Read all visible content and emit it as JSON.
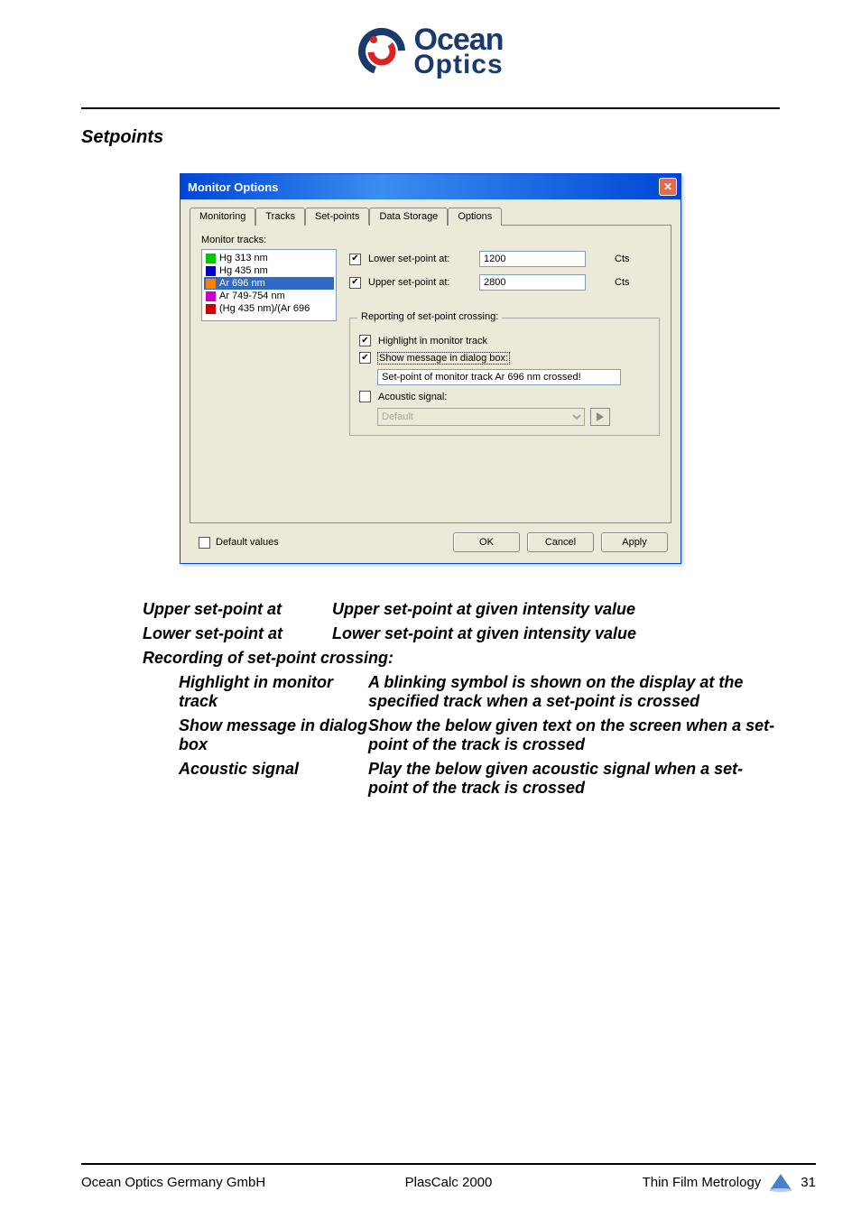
{
  "header": {
    "logo_line1": "Ocean",
    "logo_line2": "Optics"
  },
  "section_title": "Setpoints",
  "dialog": {
    "title": "Monitor Options",
    "tabs": [
      "Monitoring",
      "Tracks",
      "Set-points",
      "Data Storage",
      "Options"
    ],
    "active_tab_index": 2,
    "monitor_tracks_label": "Monitor tracks:",
    "tracks": [
      {
        "label": "Hg 313 nm",
        "color": "#00c800",
        "selected": false
      },
      {
        "label": "Hg 435 nm",
        "color": "#0000c8",
        "selected": false
      },
      {
        "label": "Ar 696 nm",
        "color": "#ff8000",
        "selected": true
      },
      {
        "label": "Ar 749-754 nm",
        "color": "#c800c8",
        "selected": false
      },
      {
        "label": "(Hg 435 nm)/(Ar 696",
        "color": "#c80000",
        "selected": false
      }
    ],
    "lower": {
      "checked": true,
      "label": "Lower set-point at:",
      "value": "1200",
      "unit": "Cts"
    },
    "upper": {
      "checked": true,
      "label": "Upper set-point at:",
      "value": "2800",
      "unit": "Cts"
    },
    "reporting": {
      "group_title": "Reporting of set-point crossing:",
      "highlight": {
        "checked": true,
        "label": "Highlight in monitor track"
      },
      "show_msg": {
        "checked": true,
        "label": "Show message in dialog box:",
        "value": "Set-point of monitor track Ar 696 nm crossed!"
      },
      "acoustic": {
        "checked": false,
        "label": "Acoustic signal:",
        "value": "Default"
      }
    },
    "default_values": {
      "checked": false,
      "label": "Default values"
    },
    "buttons": {
      "ok": "OK",
      "cancel": "Cancel",
      "apply": "Apply"
    }
  },
  "definitions": {
    "upper_term": "Upper set-point at",
    "upper_desc": "Upper set-point at given intensity value",
    "lower_term": "Lower set-point at",
    "lower_desc": "Lower set-point at given intensity value",
    "recording_heading": "Recording of set-point crossing:",
    "highlight_term": "Highlight in monitor track",
    "highlight_desc": "A blinking symbol is shown on the display at the specified track when a set-point is crossed",
    "showmsg_term": "Show message in dialog box",
    "showmsg_desc": "Show the below given text on the screen when a set-point of the track is crossed",
    "acoustic_term": "Acoustic signal",
    "acoustic_desc": "Play the below given acoustic signal when a set-point of the track is crossed"
  },
  "footer": {
    "left": "Ocean Optics Germany GmbH",
    "center": "PlasCalc 2000",
    "right": "Thin Film Metrology",
    "page": "31"
  }
}
